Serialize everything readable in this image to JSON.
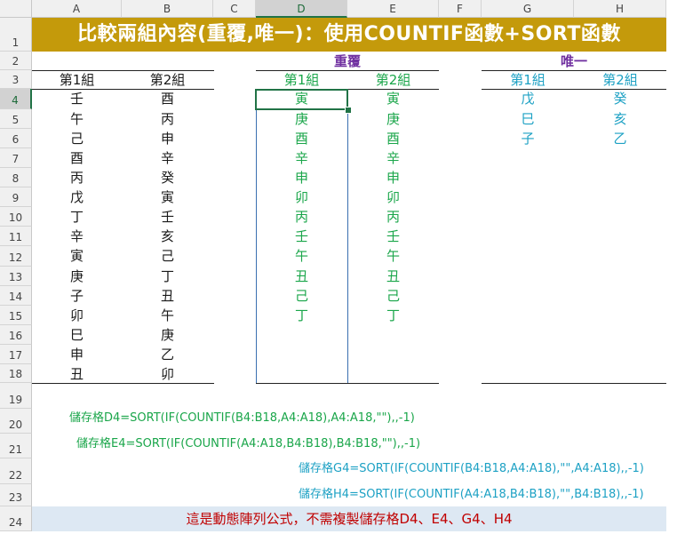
{
  "columns": [
    "A",
    "B",
    "C",
    "D",
    "E",
    "F",
    "G",
    "H"
  ],
  "rows": [
    "1",
    "2",
    "3",
    "4",
    "5",
    "6",
    "7",
    "8",
    "9",
    "10",
    "11",
    "12",
    "13",
    "14",
    "15",
    "16",
    "17",
    "18",
    "19",
    "20",
    "21",
    "22",
    "23",
    "24"
  ],
  "title": "比較兩組內容(重覆,唯一)：使用COUNTIF函數+SORT函數",
  "sections": {
    "duplicate": "重覆",
    "unique": "唯一"
  },
  "headers": {
    "group1": "第1組",
    "group2": "第2組"
  },
  "group1": [
    "壬",
    "午",
    "己",
    "酉",
    "丙",
    "戊",
    "丁",
    "辛",
    "寅",
    "庚",
    "子",
    "卯",
    "巳",
    "申",
    "丑"
  ],
  "group2": [
    "酉",
    "丙",
    "申",
    "辛",
    "癸",
    "寅",
    "壬",
    "亥",
    "己",
    "丁",
    "丑",
    "午",
    "庚",
    "乙",
    "卯"
  ],
  "dup_d": [
    "寅",
    "庚",
    "酉",
    "辛",
    "申",
    "卯",
    "丙",
    "壬",
    "午",
    "丑",
    "己",
    "丁"
  ],
  "dup_e": [
    "寅",
    "庚",
    "酉",
    "辛",
    "申",
    "卯",
    "丙",
    "壬",
    "午",
    "丑",
    "己",
    "丁"
  ],
  "uniq_g": [
    "戊",
    "巳",
    "子"
  ],
  "uniq_h": [
    "癸",
    "亥",
    "乙"
  ],
  "formulas": {
    "d4": "儲存格D4=SORT(IF(COUNTIF(B4:B18,A4:A18),A4:A18,\"\"),,-1)",
    "e4": "儲存格E4=SORT(IF(COUNTIF(A4:A18,B4:B18),B4:B18,\"\"),,-1)",
    "g4": "儲存格G4=SORT(IF(COUNTIF(B4:B18,A4:A18),\"\",A4:A18),,-1)",
    "h4": "儲存格H4=SORT(IF(COUNTIF(A4:A18,B4:B18),\"\",B4:B18),,-1)"
  },
  "note": "這是動態陣列公式，不需複製儲存格D4、E4、G4、H4",
  "colors": {
    "title_bg": "#c49a0b",
    "green": "#1aa64a",
    "cyan": "#1da1c4",
    "purple": "#7030a0",
    "note_red": "#c00000",
    "note_bg": "#dde8f3",
    "selection": "#217346"
  },
  "selected_cell": "D4"
}
